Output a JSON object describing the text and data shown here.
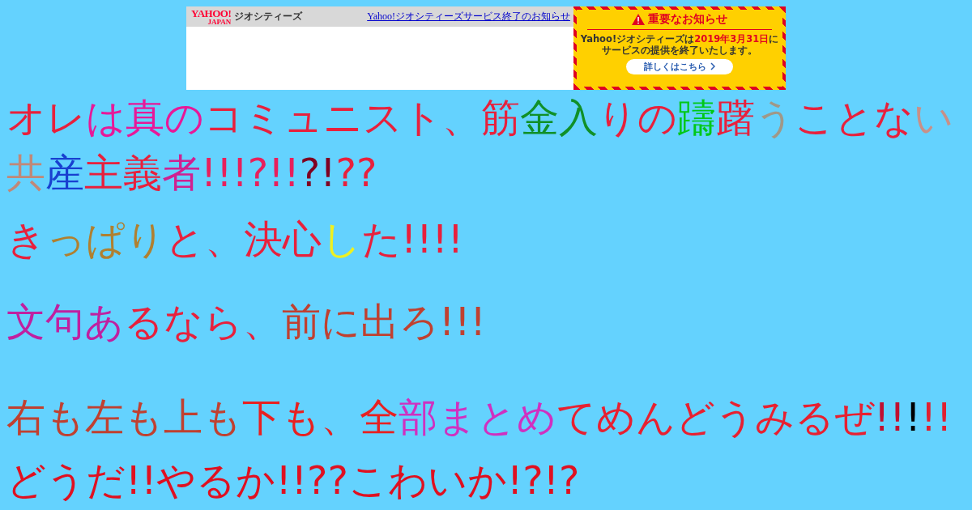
{
  "banner": {
    "logo": "YAHOO!",
    "logo_sub": "JAPAN",
    "service": "ジオシティーズ",
    "link": "Yahoo!ジオシティーズサービス終了のお知らせ",
    "notice": {
      "title": "重要なお知らせ",
      "message_before": "Yahoo!ジオシティーズは",
      "date": "2019年3月31日",
      "message_after": "にサービスの提供を終了いたします。",
      "button": "詳しくはこちら"
    }
  },
  "paragraphs": [
    {
      "segments": [
        {
          "text": "オレ",
          "color": "#e8203c"
        },
        {
          "text": "は真の",
          "color": "#e81898"
        },
        {
          "text": "コミュニスト、筋",
          "color": "#e8203c"
        },
        {
          "text": "金入",
          "color": "#109028"
        },
        {
          "text": "りの",
          "color": "#e8203c"
        },
        {
          "text": "躊",
          "color": "#00c818"
        },
        {
          "text": "躇",
          "color": "#e8203c"
        },
        {
          "text": "う",
          "color": "#a09888"
        },
        {
          "text": "ことな",
          "color": "#e8203c"
        },
        {
          "text": "い",
          "color": "#c89088"
        },
        {
          "text": "共",
          "color": "#c08878"
        },
        {
          "text": "産",
          "color": "#1840d0"
        },
        {
          "text": "主義",
          "color": "#e8203c"
        },
        {
          "text": "者",
          "color": "#d02090"
        },
        {
          "text": "!!!?!!",
          "color": "#e8205c"
        },
        {
          "text": "?!",
          "color": "#800020"
        },
        {
          "text": "??",
          "color": "#e8203c"
        }
      ]
    },
    {
      "segments": [
        {
          "text": "き",
          "color": "#e8203c"
        },
        {
          "text": "っぱり",
          "color": "#b08030"
        },
        {
          "text": "と、決心",
          "color": "#e8203c"
        },
        {
          "text": "し",
          "color": "#f0f020"
        },
        {
          "text": "た!!!!",
          "color": "#e8203c"
        }
      ]
    },
    {
      "segments": [
        {
          "text": "文句あ",
          "color": "#c020a0"
        },
        {
          "text": "るなら、",
          "color": "#e8203c"
        },
        {
          "text": "前に出ろ!!!",
          "color": "#c04030"
        }
      ]
    },
    {
      "segments": [
        {
          "text": "右も左も上も",
          "color": "#c04030"
        },
        {
          "text": "下も、全",
          "color": "#e82020"
        },
        {
          "text": "部まとめ",
          "color": "#d030c0"
        },
        {
          "text": "てめんどうみるぜ",
          "color": "#e82030"
        },
        {
          "text": "!!",
          "color": "#c01030"
        },
        {
          "text": "!",
          "color": "#000000"
        },
        {
          "text": "!!",
          "color": "#e02030"
        }
      ]
    },
    {
      "segments": [
        {
          "text": "どうだ!!やるか!!??こわいか!?!?",
          "color": "#e01020"
        }
      ]
    }
  ]
}
